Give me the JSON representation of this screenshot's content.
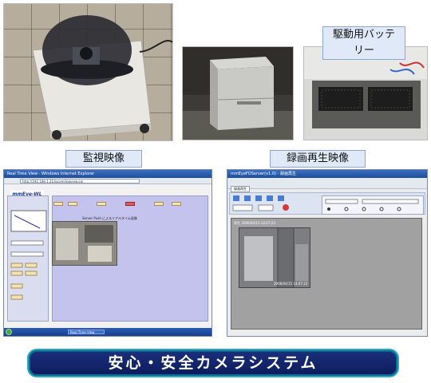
{
  "captions": {
    "battery": "駆動用バッテリー",
    "monitor": "監視映像",
    "playback": "録画再生映像"
  },
  "monitor_window": {
    "title": "Real Time View - Windows Internet Explorer",
    "address": "http://192.168.1.21/ipcam/jpgview.cgi",
    "logo": "mmEye-WL",
    "header": "Server Push によるリアルタイム画像",
    "task_item": "Real Time View"
  },
  "playback_window": {
    "title": "mmEyeFOServer(v1.0) - 録画再生",
    "tab_label": "録画再生",
    "video_label": "再生 2006/04/15-14:07:23",
    "timestamp": "2006/04/15 14:07:23"
  },
  "banner": {
    "text": "安心・安全カメラシステム"
  },
  "colors": {
    "banner_bg": "#1b2f7c",
    "banner_border": "#2aa8c4",
    "caption_bg": "#dfe9f7"
  }
}
